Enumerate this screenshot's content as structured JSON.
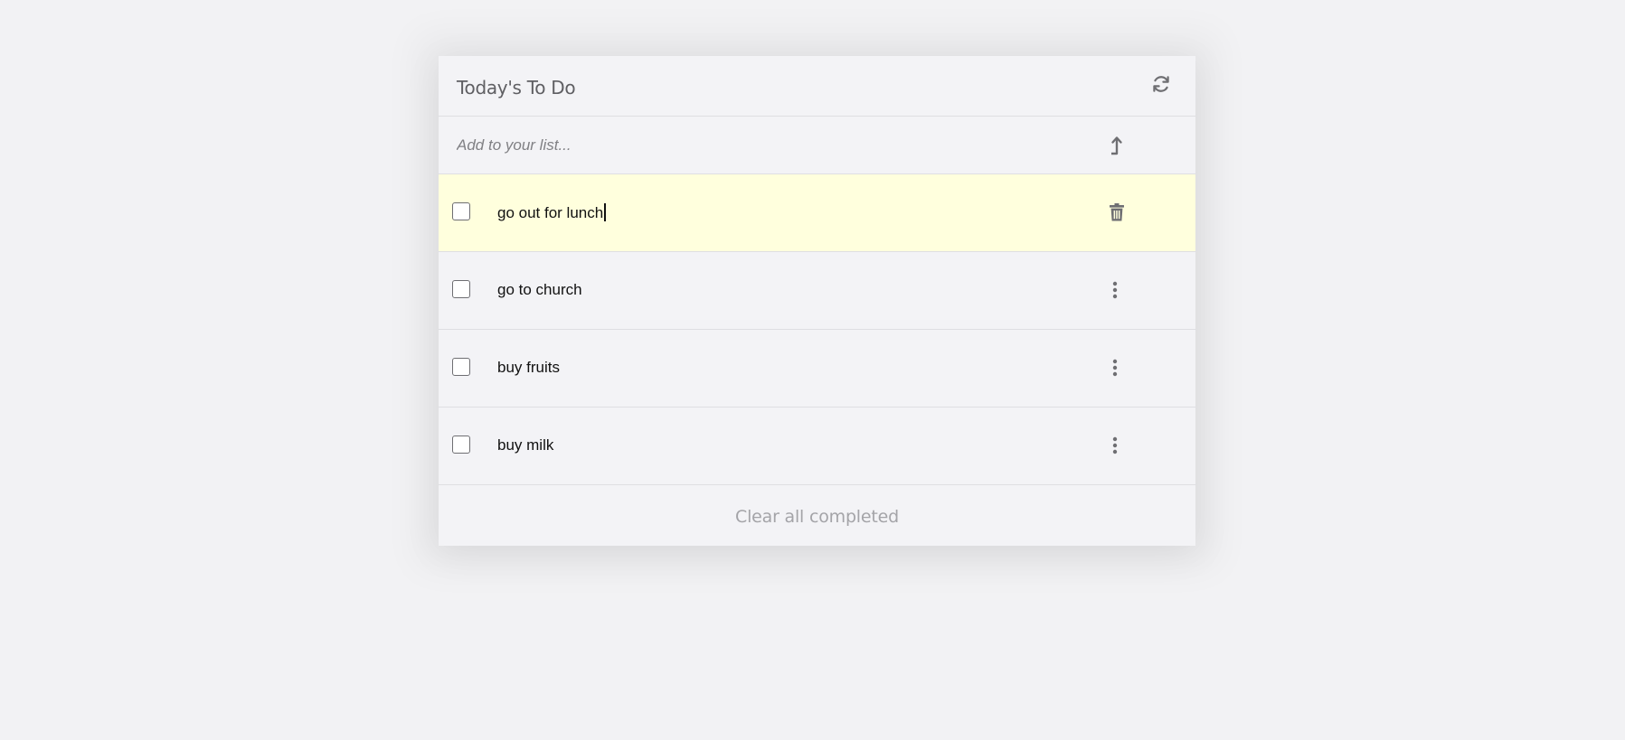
{
  "app": {
    "title": "Today's To Do",
    "refresh_icon": "refresh-icon"
  },
  "add": {
    "placeholder": "Add to your list...",
    "value": "",
    "submit_icon": "arrow-up-icon"
  },
  "items": [
    {
      "label": "go out for lunch",
      "completed": false,
      "editing": true,
      "action_icon": "trash-icon"
    },
    {
      "label": "go to church",
      "completed": false,
      "editing": false,
      "action_icon": "more-vertical-icon"
    },
    {
      "label": "buy fruits",
      "completed": false,
      "editing": false,
      "action_icon": "more-vertical-icon"
    },
    {
      "label": "buy milk",
      "completed": false,
      "editing": false,
      "action_icon": "more-vertical-icon"
    }
  ],
  "footer": {
    "clear_label": "Clear all completed"
  },
  "colors": {
    "background": "#f2f2f4",
    "card": "#f3f3f6",
    "editing_row": "#ffffdd",
    "icon": "#6e6e72",
    "muted_text": "#a4a4a8"
  }
}
